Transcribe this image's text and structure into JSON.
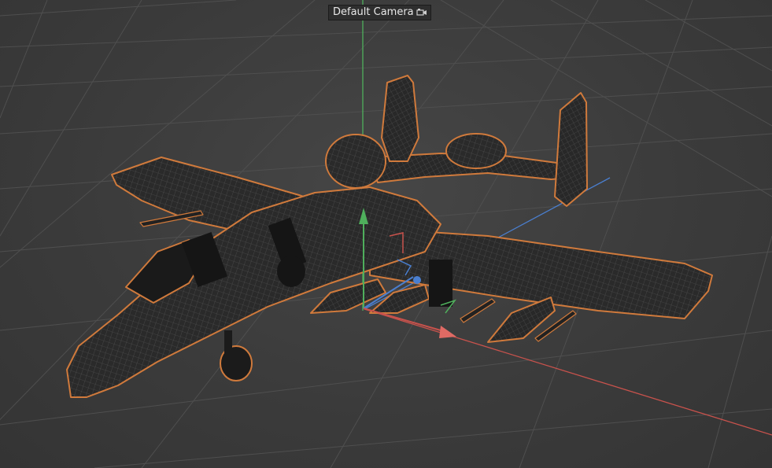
{
  "viewport": {
    "camera_label": "Default Camera",
    "camera_icon": "camera-icon",
    "background_color": "#3d3d3d",
    "grid_color": "#4e4e4e",
    "axis_colors": {
      "x": "#d9534f",
      "y": "#4caf50",
      "z": "#4a7fd0"
    },
    "selection_outline_color": "#d07a3c",
    "model": {
      "name": "aircraft-wireframe",
      "display": "wireframe",
      "selected": true
    }
  }
}
